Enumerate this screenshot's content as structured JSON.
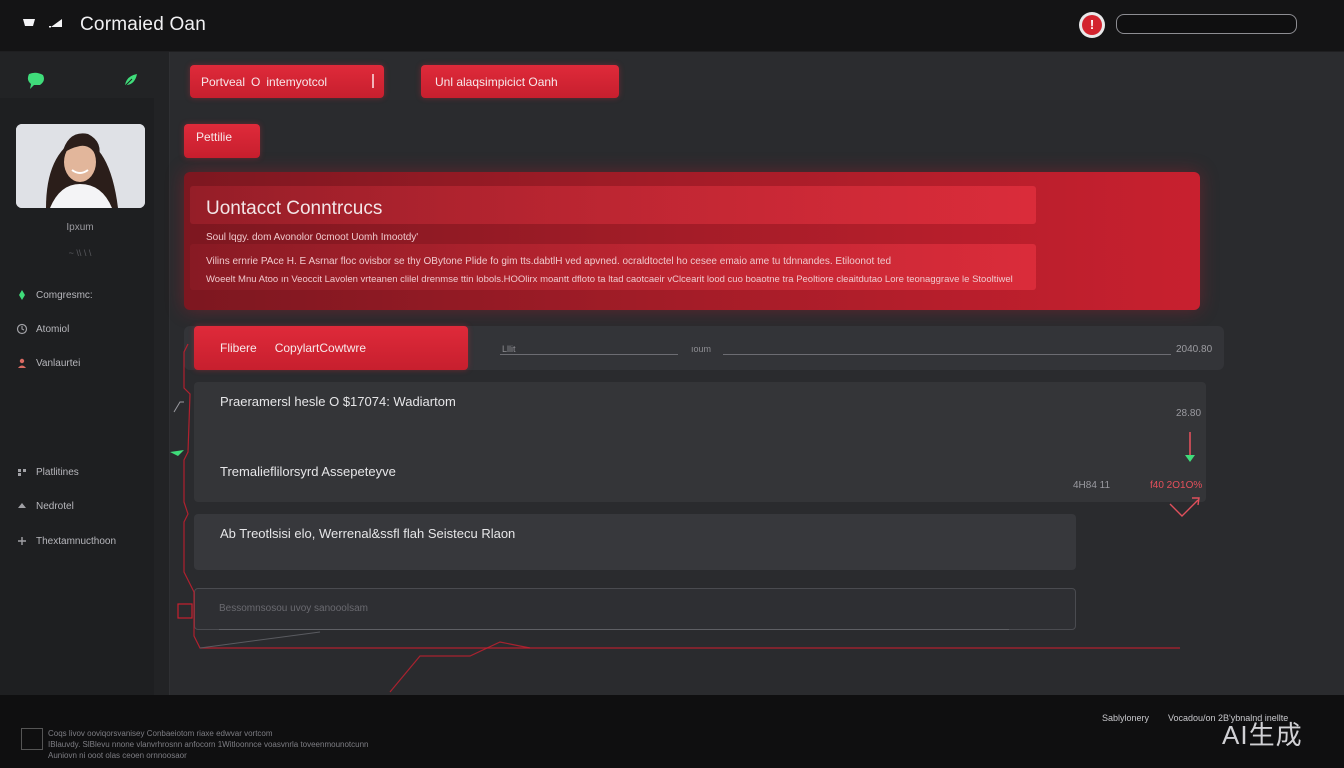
{
  "app": {
    "title": "Cormaied Oan"
  },
  "header": {
    "alert_glyph": "!",
    "search_value": ""
  },
  "sidebar": {
    "user_name": "Ipxum",
    "user_sub": "~ \\\\ \\ \\",
    "nav_top": [
      {
        "label": "Comgresmc:"
      },
      {
        "label": "Atomiol"
      },
      {
        "label": "Vanlaurtei"
      }
    ],
    "nav_bottom": [
      {
        "label": "Platlitines"
      },
      {
        "label": "Nedrotel"
      },
      {
        "label": "Thextamnucthoon"
      }
    ]
  },
  "toolbar": {
    "primary_left": "Portveal",
    "primary_sep": "O",
    "primary_right": "intemyotcol",
    "secondary": "Unl alaqsimpicict Oanh",
    "profile": "Pettilie"
  },
  "contact": {
    "title": "Uontacct Conntrcucs",
    "line1": "Soul lqgy. dom Avonolor 0cmoot Uomh Imootdy'",
    "line2": "Vilins ernrie PAce H. E Asrnar floc ovisbor se thy OBytone Plide fo gim tts.dabtlH ved apvned. ocraldtoctel ho cesee emaio ame tu tdnnandes. Etiloonot ted",
    "line3": "Woeelt Mnu Atoo ın Veoccit Lavolen vrteanen clilel drenmse ttin lobols.HOOlirx moantt dfloto ta ltad caotcaeir vClcearit lood cuo boaotne tra Peoltiore cleaitdutao Lore teonaggrave le Stooltiwel"
  },
  "tabrow": {
    "tab_label_a": "Flibere",
    "tab_label_b": "CopylartCowtwre",
    "field_a_label": "Lllit",
    "field_b_label": "ıoum",
    "value": "2040.80"
  },
  "list": {
    "row1": "Praeramersl hesle O $17074: Wadiartom",
    "row2": "Tremalieflilorsyrd Assepeteyve",
    "row3": "Ab Treotlsisi elo, Werrenal&ssfl flah Seistecu Rlaon",
    "stat_right_1": "28.80",
    "stat_left_2": "4H84 11",
    "stat_red_2": "f40 2O1O%",
    "placeholder": "Bessomnsosou uvoy sanooolsam"
  },
  "footer": {
    "line1": "Coqs livov  ooviqorsvanisey Conbaeiotom riaxe edwvar vortcom",
    "line2": "IBlauvdy. SlBlevu nnone vlanvrhrosnn anfocorn 1Witloonnce voasvnrla toveenmounotcunn",
    "line3": "Auniovn ni ooot olas ceoen ornnoosaor",
    "right_a": "Sablylonery",
    "right_b": "Vocadou/on 2B'ybnalnd inellte",
    "watermark": "AI生成"
  },
  "colors": {
    "accent_red": "#d3242f",
    "accent_green": "#3fdc7a",
    "background": "#2a2b2e",
    "topbar": "#141415"
  }
}
